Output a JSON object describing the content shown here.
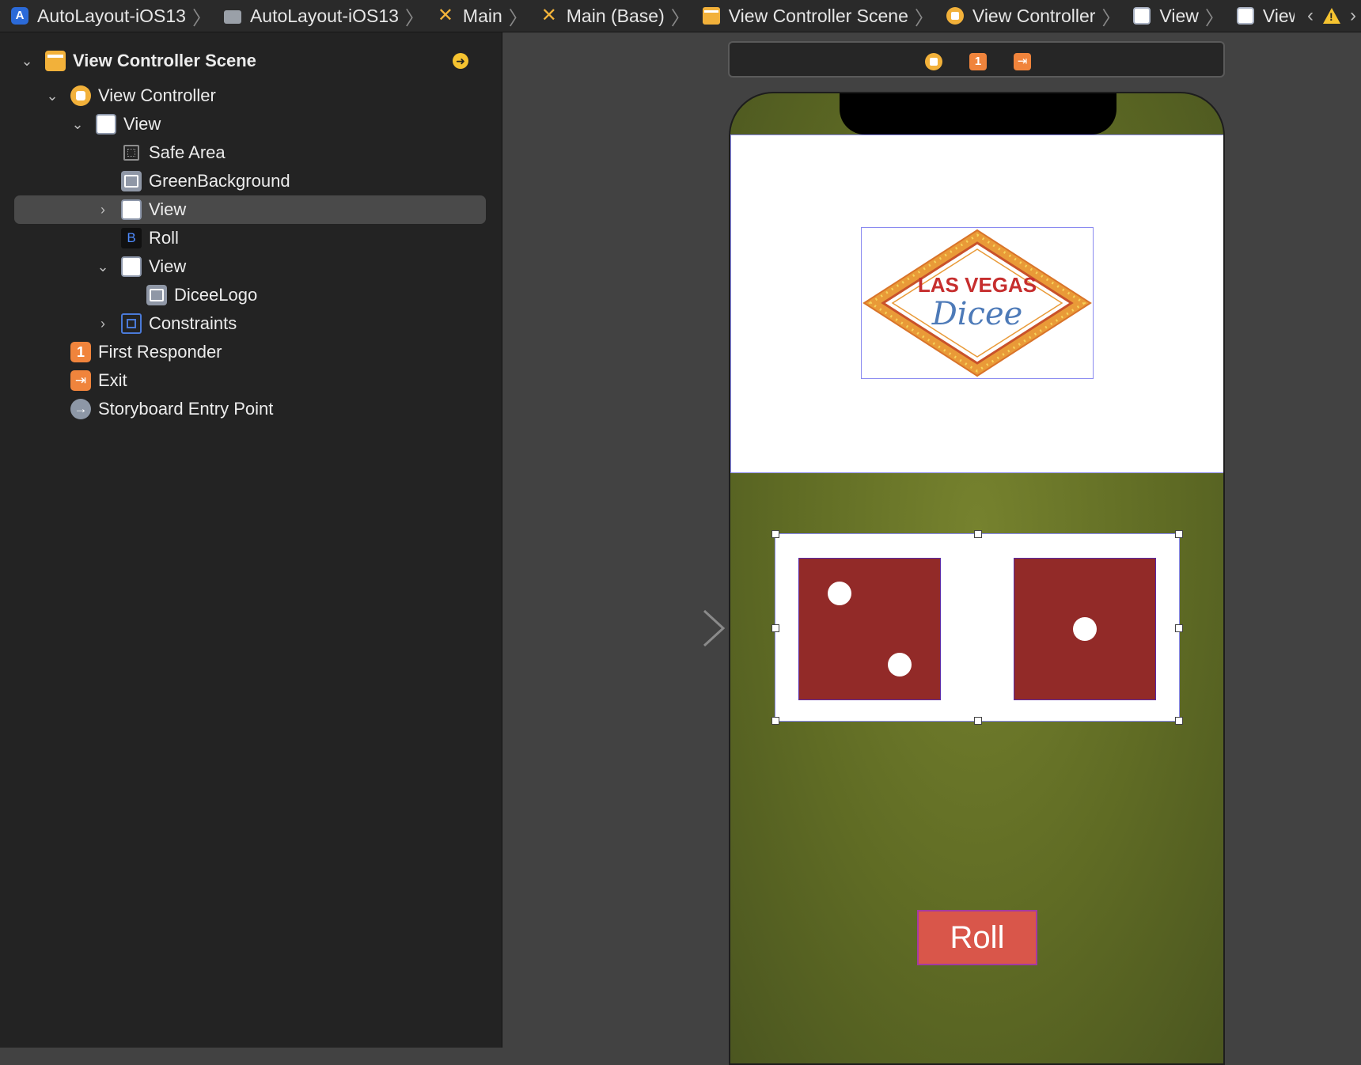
{
  "breadcrumbs": [
    {
      "label": "AutoLayout-iOS13",
      "icon": "app-icon"
    },
    {
      "label": "AutoLayout-iOS13",
      "icon": "folder-icon"
    },
    {
      "label": "Main",
      "icon": "storyboard-icon"
    },
    {
      "label": "Main (Base)",
      "icon": "storyboard-icon"
    },
    {
      "label": "View Controller Scene",
      "icon": "scene-icon"
    },
    {
      "label": "View Controller",
      "icon": "view-controller-icon"
    },
    {
      "label": "View",
      "icon": "view-icon"
    },
    {
      "label": "View",
      "icon": "view-icon"
    }
  ],
  "outline": {
    "items": [
      {
        "label": "View Controller Scene",
        "icon": "scene-icon",
        "disclosure": "expanded",
        "bold": true
      },
      {
        "label": "View Controller",
        "icon": "view-controller-icon",
        "disclosure": "expanded"
      },
      {
        "label": "View",
        "icon": "view-icon",
        "disclosure": "expanded"
      },
      {
        "label": "Safe Area",
        "icon": "safe-area-icon"
      },
      {
        "label": "GreenBackground",
        "icon": "image-view-icon"
      },
      {
        "label": "View",
        "icon": "view-icon",
        "disclosure": "collapsed",
        "selected": true
      },
      {
        "label": "Roll",
        "icon": "button-icon",
        "icon_text": "B"
      },
      {
        "label": "View",
        "icon": "view-icon",
        "disclosure": "expanded"
      },
      {
        "label": "DiceeLogo",
        "icon": "image-view-icon"
      },
      {
        "label": "Constraints",
        "icon": "constraints-icon",
        "disclosure": "collapsed"
      },
      {
        "label": "First Responder",
        "icon": "first-responder-icon",
        "icon_text": "1"
      },
      {
        "label": "Exit",
        "icon": "exit-icon"
      },
      {
        "label": "Storyboard Entry Point",
        "icon": "entry-point-icon"
      }
    ]
  },
  "canvas": {
    "logo": {
      "line1": "LAS VEGAS",
      "line2": "Dicee"
    },
    "dice": [
      {
        "face": 2
      },
      {
        "face": 1
      }
    ],
    "roll_button": "Roll"
  },
  "colors": {
    "table_green": "#6b7729",
    "die_red": "#922a28",
    "button_red": "#d9564a",
    "selection_purple": "#8a8af0",
    "accent_orange": "#f0843c",
    "accent_yellow": "#f2b13a"
  }
}
